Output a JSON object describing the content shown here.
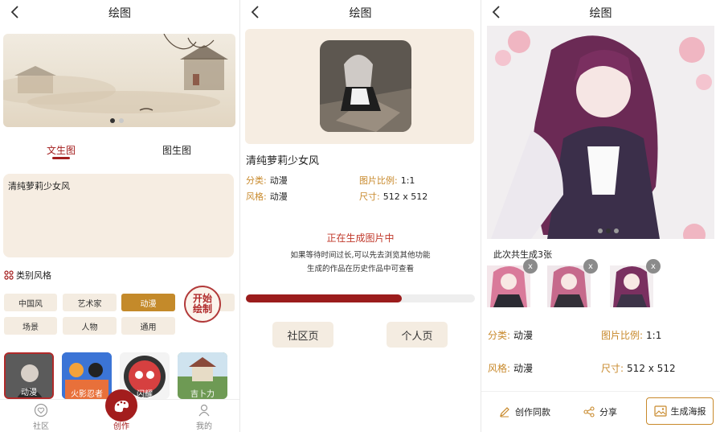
{
  "screen1": {
    "title": "绘图",
    "tabs": [
      "文生图",
      "图生图"
    ],
    "prompt_text": "清纯萝莉少女风",
    "category_title": "类别风格",
    "chips": [
      "中国风",
      "艺术家",
      "动漫",
      "场景",
      "人物",
      "通用"
    ],
    "selected_chip": "动漫",
    "stamp_text": "开始绘制",
    "thumbs": [
      "动漫",
      "火影忍者",
      "闪耀",
      "吉卜力"
    ],
    "tabbar": {
      "community": "社区",
      "create": "创作",
      "mine": "我的"
    }
  },
  "screen2": {
    "title": "绘图",
    "prompt_title": "清纯萝莉少女风",
    "category_label": "分类:",
    "category_value": "动漫",
    "style_label": "风格:",
    "style_value": "动漫",
    "ratio_label": "图片比例:",
    "ratio_value": "1:1",
    "size_label": "尺寸:",
    "size_value": "512 x 512",
    "status_main": "正在生成图片中",
    "status_sub1": "如果等待时间过长,可以先去浏览其他功能",
    "status_sub2": "生成的作品在历史作品中可查看",
    "progress": 0.68,
    "btn_community": "社区页",
    "btn_personal": "个人页"
  },
  "screen3": {
    "title": "绘图",
    "count_text": "此次共生成3张",
    "close_symbol": "x",
    "category_label": "分类:",
    "category_value": "动漫",
    "ratio_label": "图片比例:",
    "ratio_value": "1:1",
    "style_label": "风格:",
    "style_value": "动漫",
    "size_label": "尺寸:",
    "size_value": "512 x 512",
    "act_same": "创作同款",
    "act_share": "分享",
    "act_poster": "生成海报"
  },
  "colors": {
    "accent": "#a31d1d",
    "gold": "#c8892b",
    "card_bg": "#f6ede2",
    "chip_selected": "#c48a2a"
  }
}
